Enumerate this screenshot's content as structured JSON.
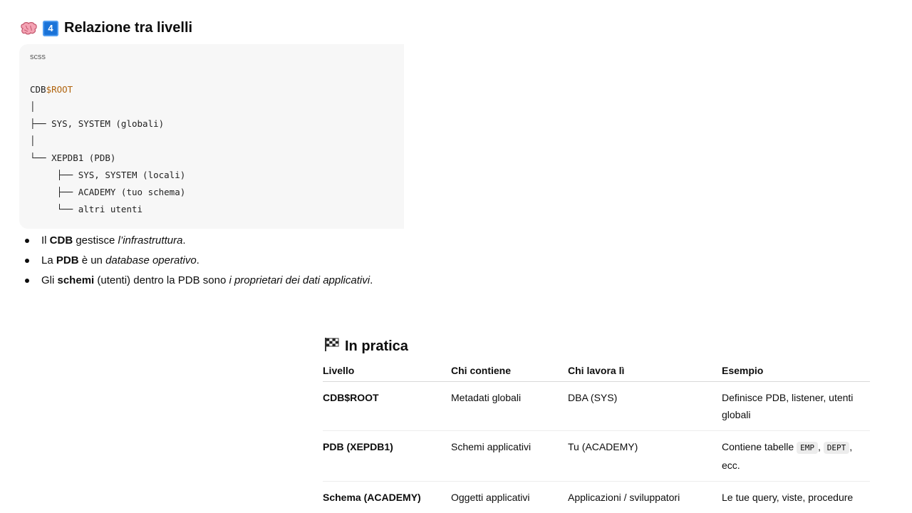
{
  "section1": {
    "title": "Relazione tra livelli",
    "keycap": "4",
    "icon": "brain-icon"
  },
  "codeblock": {
    "language": "scss",
    "lines": [
      {
        "plain": "CDB",
        "accent": "$ROOT"
      },
      {
        "plain": "│"
      },
      {
        "plain": "├── SYS, SYSTEM (globali)"
      },
      {
        "plain": "│"
      },
      {
        "plain": "└── XEPDB1 (PDB)"
      },
      {
        "plain": "     ├── SYS, SYSTEM (locali)"
      },
      {
        "plain": "     ├── ACADEMY (tuo schema)"
      },
      {
        "plain": "     └── altri utenti"
      }
    ]
  },
  "bullets": [
    {
      "a": "Il ",
      "b": "CDB",
      "c": " gestisce ",
      "i": "l’infrastruttura",
      "d": "."
    },
    {
      "a": "La ",
      "b": "PDB",
      "c": " è un ",
      "i": "database operativo",
      "d": "."
    },
    {
      "a": "Gli ",
      "b": "schemi",
      "c": " (utenti) dentro la PDB sono ",
      "i": "i proprietari dei dati applicativi",
      "d": "."
    }
  ],
  "section2": {
    "title": "In pratica",
    "icon": "checkered-flag-icon"
  },
  "table": {
    "headers": [
      "Livello",
      "Chi contiene",
      "Chi lavora lì",
      "Esempio"
    ],
    "rows": [
      {
        "c1": "CDB$ROOT",
        "c2": "Metadati globali",
        "c3": "DBA (SYS)",
        "c4": "Definisce PDB, listener, utenti globali"
      },
      {
        "c1": "PDB (XEPDB1)",
        "c2": "Schemi applicativi",
        "c3": "Tu (ACADEMY)",
        "c4_pre": "Contiene tabelle ",
        "c4_code1": "EMP",
        "c4_mid": ", ",
        "c4_code2": "DEPT",
        "c4_post": ", ecc."
      },
      {
        "c1": "Schema (ACADEMY)",
        "c2": "Oggetti applicativi",
        "c3": "Applicazioni / sviluppatori",
        "c4": "Le tue query, viste, procedure"
      }
    ]
  },
  "colors": {
    "keycap": "#1a73d8",
    "code_accent": "#b0640e",
    "code_bg": "#f7f7f7"
  }
}
